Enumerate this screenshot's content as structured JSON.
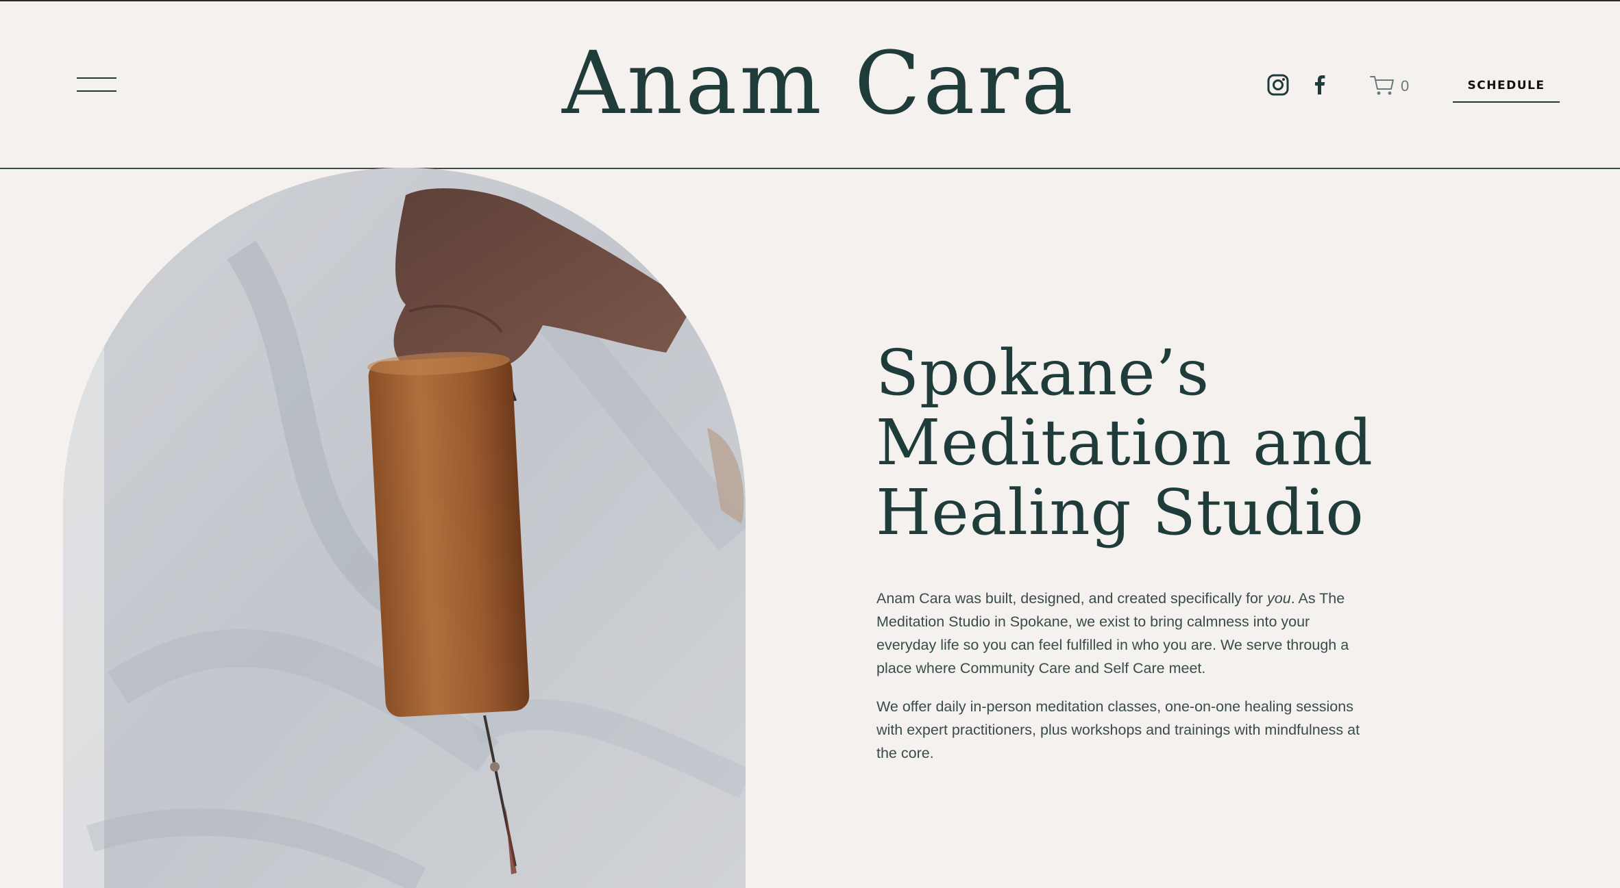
{
  "header": {
    "logo_text": "Anam Cara",
    "menu_icon": "hamburger-menu-icon",
    "social": [
      {
        "name": "instagram-icon"
      },
      {
        "name": "facebook-icon"
      }
    ],
    "cart_icon": "cart-icon",
    "cart_count": "0",
    "schedule_label": "SCHEDULE"
  },
  "hero": {
    "heading_lines": [
      "Spokane’s",
      "Meditation and",
      "Healing Studio"
    ],
    "image_alt": "Hand holding a wooden koshi wind chime"
  },
  "intro": {
    "p1_before": "Anam Cara was built, designed, and created specifically for ",
    "p1_em": "you",
    "p1_after": ". As The Meditation Studio in Spokane, we exist to bring calmness into your everyday life so you can feel fulfilled in who you are. We serve through a place where Community Care and Self Care meet.",
    "p2": "We offer daily in-person meditation classes, one-on-one healing sessions with expert practitioners, plus workshops and trainings with mindfulness at the core."
  },
  "colors": {
    "background": "#f4f1ee",
    "brand_text": "#1f3b3a",
    "body_text": "#3a4b4b"
  }
}
